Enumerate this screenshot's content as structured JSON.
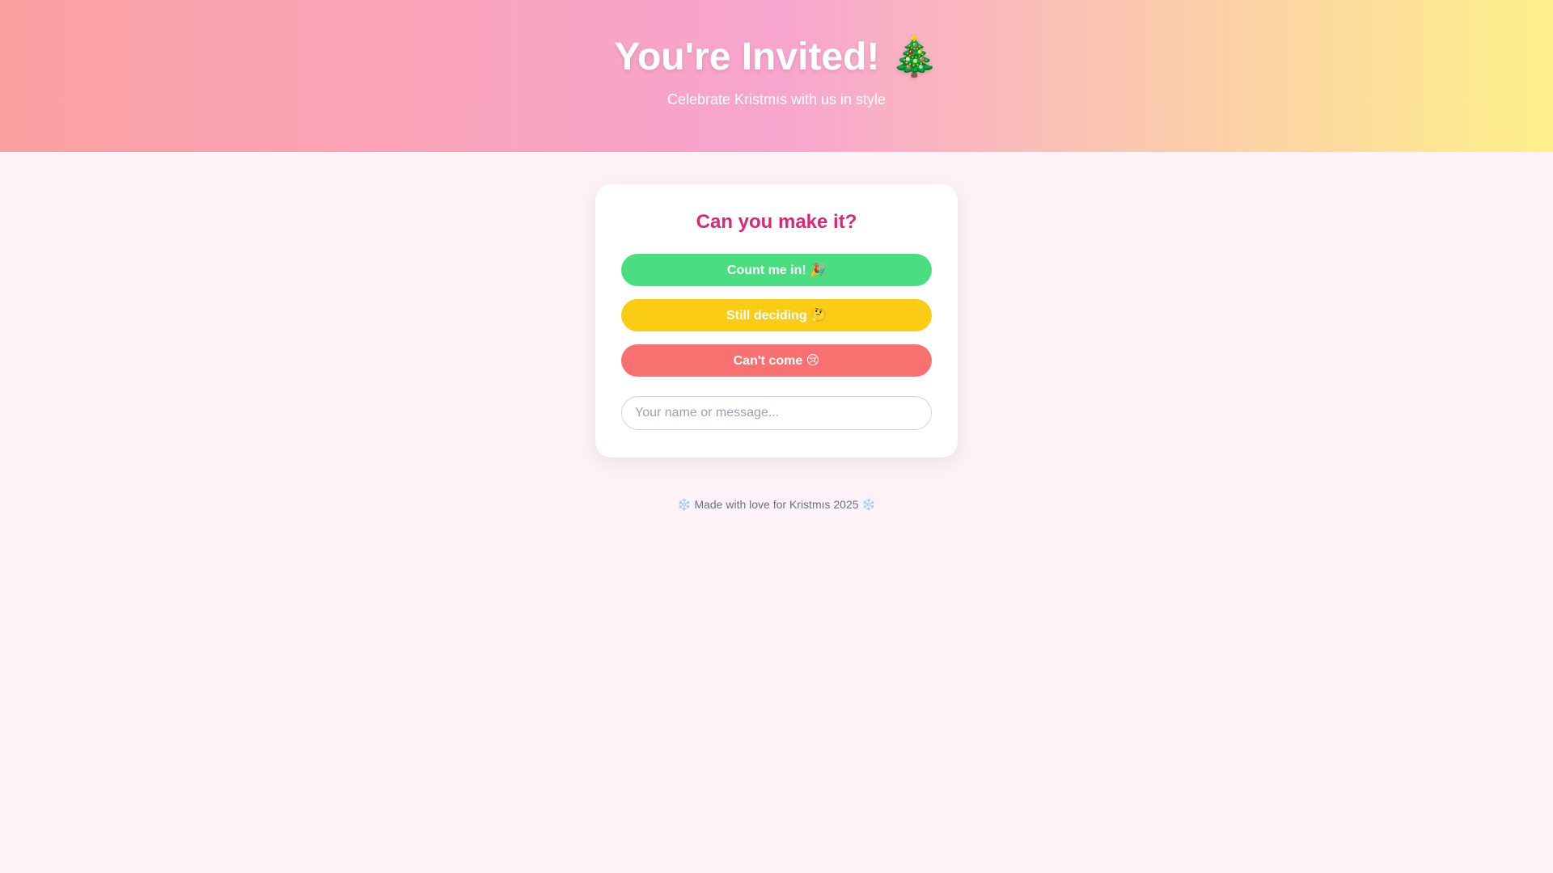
{
  "hero": {
    "title": "You're Invited! 🎄",
    "subtitle": "Celebrate Kristmıs with us in style"
  },
  "card": {
    "title": "Can you make it?",
    "buttons": {
      "yes": "Count me in! 🎉",
      "maybe": "Still deciding 🤔",
      "no": "Can't come 😢"
    },
    "message_input": {
      "value": "",
      "placeholder": "Your name or message..."
    }
  },
  "footer": {
    "text": "❄️ Made with love for Kristmıs 2025 ❄️"
  },
  "colors": {
    "accent": "#db2777",
    "yes": "#4ade80",
    "maybe": "#facc15",
    "no": "#f87171",
    "background": "#fdf2f8"
  }
}
